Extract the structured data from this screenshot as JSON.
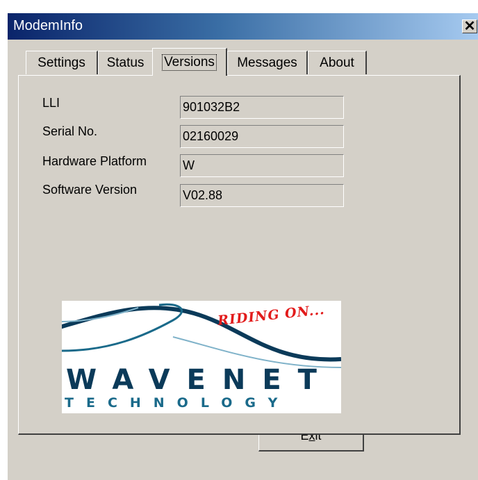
{
  "window": {
    "title": "ModemInfo"
  },
  "tabs": [
    {
      "label": "Settings",
      "active": false
    },
    {
      "label": "Status",
      "active": false
    },
    {
      "label": "Versions",
      "active": true
    },
    {
      "label": "Messages",
      "active": false
    },
    {
      "label": "About",
      "active": false
    }
  ],
  "fields": [
    {
      "label": "LLI",
      "value": "901032B2"
    },
    {
      "label": "Serial No.",
      "value": "02160029"
    },
    {
      "label": "Hardware Platform",
      "value": "W"
    },
    {
      "label": "Software Version",
      "value": "V02.88"
    }
  ],
  "logo": {
    "tagline": "RIDING ON...",
    "wordmark": "WAVENET",
    "subtitle": "TECHNOLOGY",
    "colors": {
      "wave": "#0b3a59",
      "tagline": "#e21b1b"
    }
  },
  "buttons": {
    "exit_prefix": "E",
    "exit_mnemonic": "x",
    "exit_suffix": "it"
  },
  "colors": {
    "titlebar_start": "#0a246a",
    "titlebar_end": "#a6caf0",
    "face": "#d4d0c8"
  }
}
